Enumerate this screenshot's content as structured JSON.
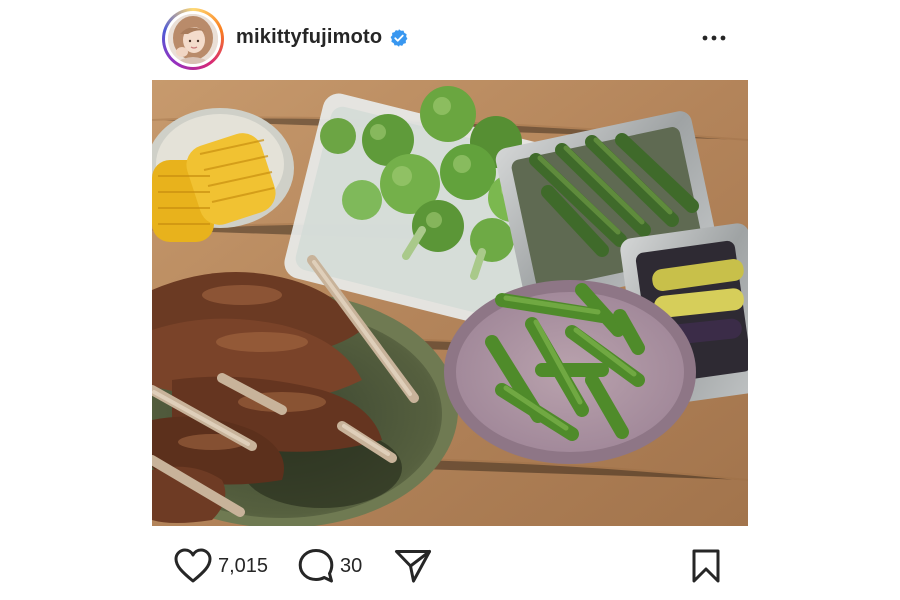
{
  "post": {
    "username": "mikittyfujimoto",
    "verified": true,
    "likes_count": "7,015",
    "comments_count": "30"
  },
  "icons": {
    "avatar": "profile-avatar",
    "verified": "verified-badge-icon",
    "more": "more-options-icon",
    "like": "heart-icon",
    "comment": "comment-bubble-icon",
    "share": "paper-plane-icon",
    "save": "bookmark-icon"
  },
  "colors": {
    "text": "#262626",
    "verified_blue": "#3897f0",
    "story_ring": [
      "#feda75",
      "#fa7e1e",
      "#d62976",
      "#962fbf",
      "#4f5bd5"
    ]
  }
}
